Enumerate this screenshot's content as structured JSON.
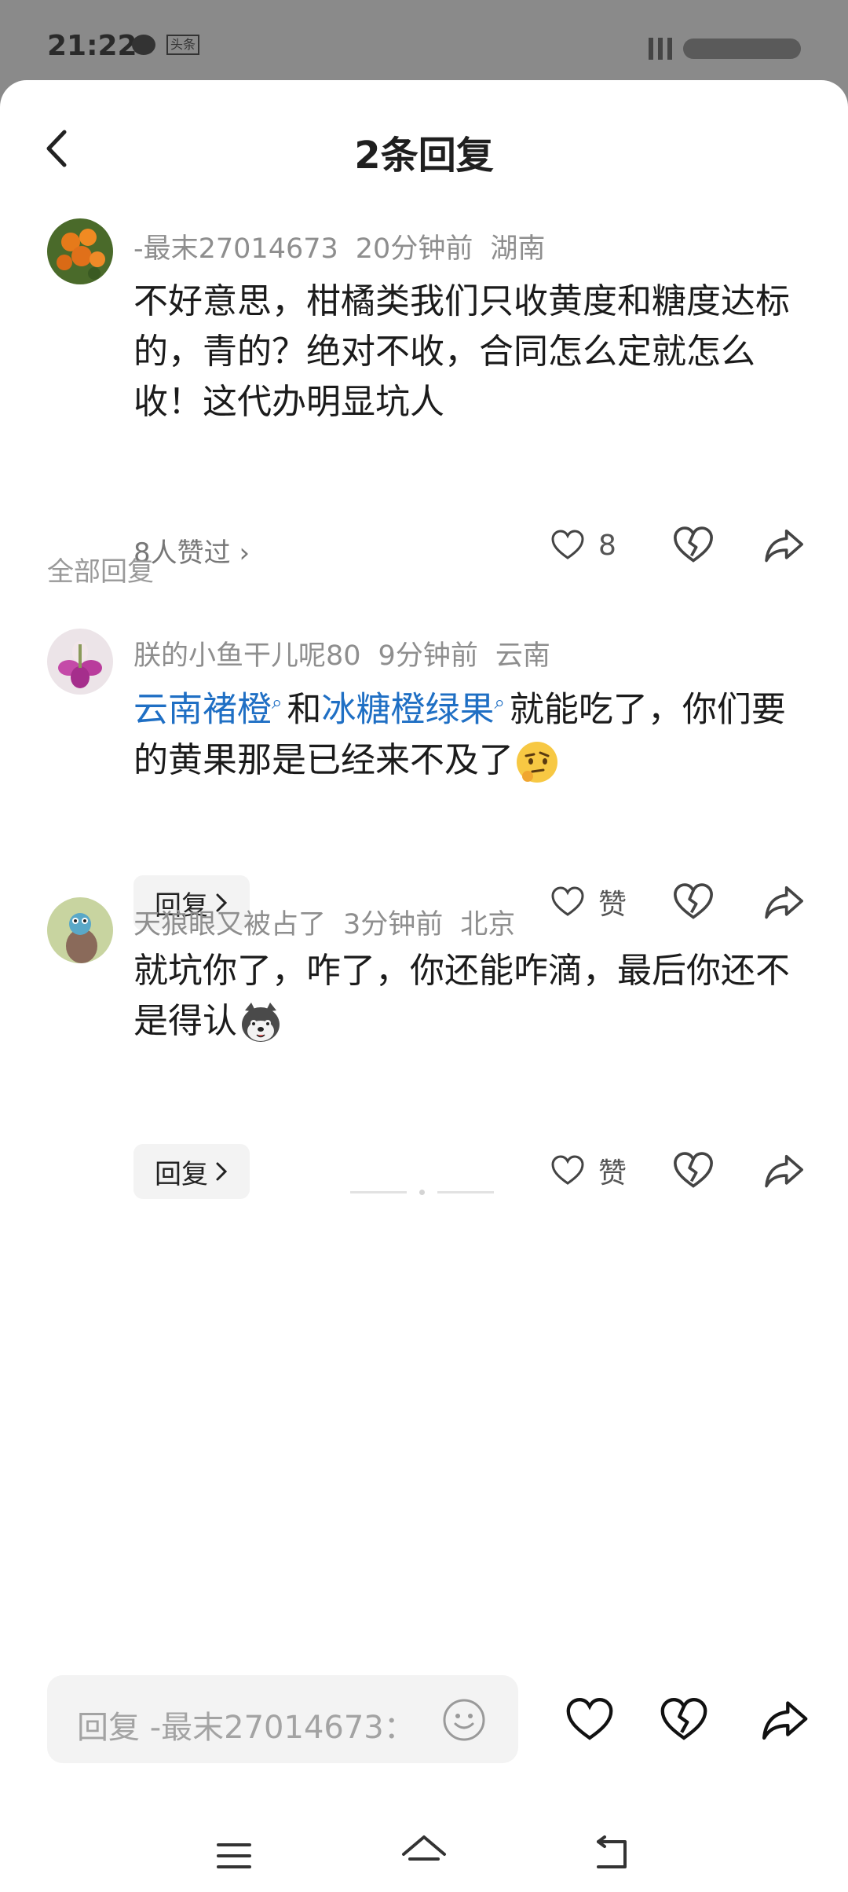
{
  "status_bar": {
    "time": "21:22",
    "app_badge": "头条"
  },
  "header": {
    "title": "2条回复"
  },
  "main_comment": {
    "username": "-最末27014673",
    "time": "20分钟前",
    "location": "湖南",
    "text": "不好意思，柑橘类我们只收黄度和糖度达标的，青的？绝对不收，合同怎么定就怎么收！这代办明显坑人",
    "likers_text": "8人赞过 ›",
    "like_count": "8"
  },
  "section_label": "全部回复",
  "replies": [
    {
      "username": "朕的小鱼干儿呢80",
      "time": "9分钟前",
      "location": "云南",
      "link1": "云南褚橙",
      "mid1": "和",
      "link2": "冰糖橙绿果",
      "tail": "就能吃了，你们要的黄果那是已经来不及了",
      "emoji": "thinking-face-emoji",
      "reply_label": "回复",
      "like_label": "赞"
    },
    {
      "username": "天狼眼又被占了",
      "time": "3分钟前",
      "location": "北京",
      "text": "就坑你了，咋了，你还能咋滴，最后你还不是得认",
      "emoji": "husky-dog-emoji",
      "reply_label": "回复",
      "like_label": "赞"
    }
  ],
  "input_bar": {
    "placeholder": "回复 -最末27014673："
  },
  "icons": [
    "back-icon",
    "heart-icon",
    "broken-heart-icon",
    "share-icon",
    "smile-icon",
    "menu-icon",
    "home-icon",
    "return-icon",
    "chevron-right-icon",
    "search-icon"
  ]
}
